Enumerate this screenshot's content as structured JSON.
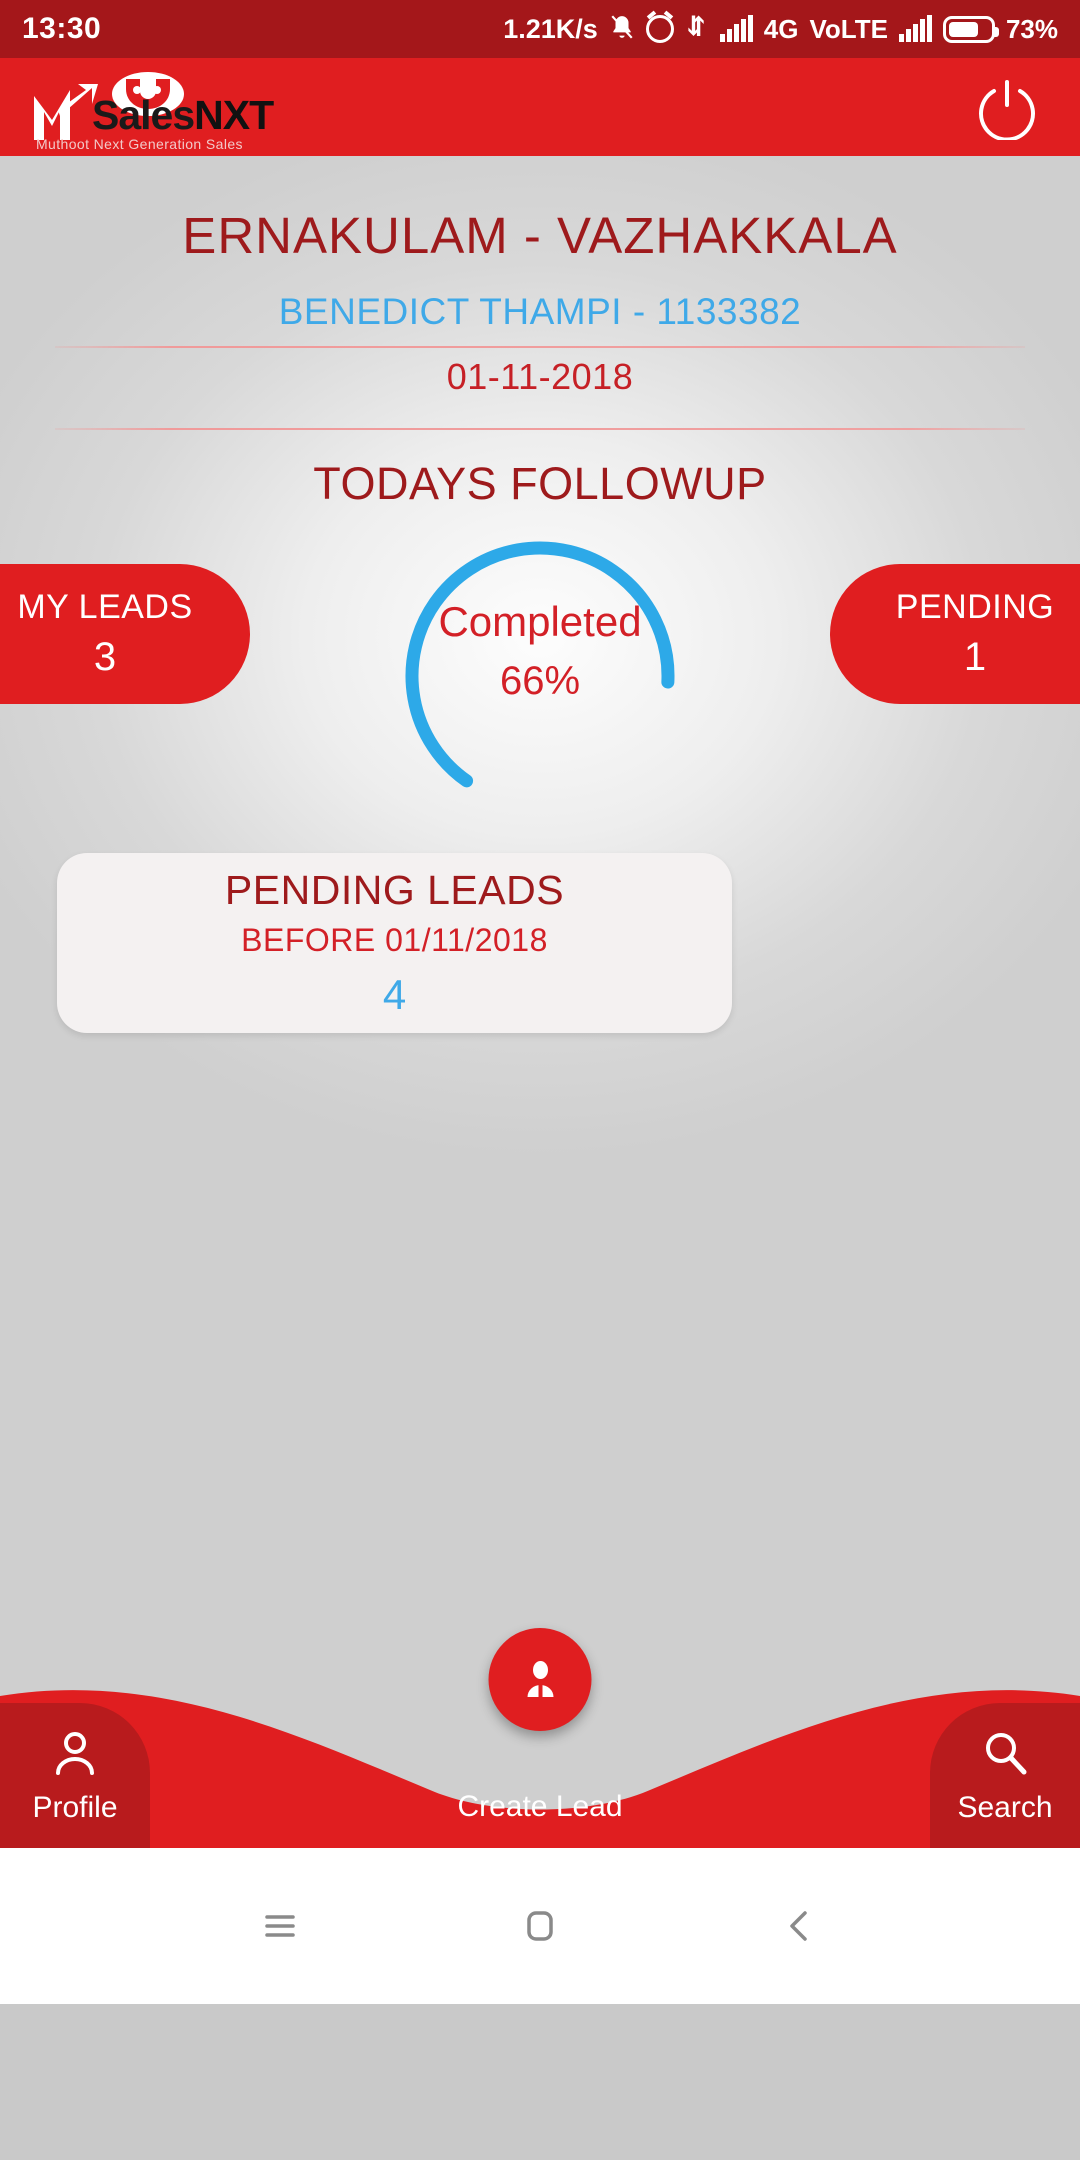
{
  "status_bar": {
    "time": "13:30",
    "net_speed": "1.21K/s",
    "network_type": "4G",
    "volte": "VoLTE",
    "battery": "73%",
    "icons": [
      "bell-muted-icon",
      "alarm-icon",
      "data-transfer-icon",
      "signal-bars-icon",
      "signal-bars-icon",
      "battery-icon"
    ]
  },
  "app_header": {
    "brand_m": "M",
    "brand_name": "SalesNXT",
    "tagline": "Muthoot Next Generation Sales",
    "power_icon": "power-icon"
  },
  "main": {
    "branch": "ERNAKULAM - VAZHAKKALA",
    "agent": "BENEDICT THAMPI - 1133382",
    "date": "01-11-2018",
    "section_title": "TODAYS FOLLOWUP",
    "progress": {
      "label": "Completed",
      "percent_text": "66%",
      "percent_value": 66
    },
    "my_leads": {
      "label": "MY LEADS",
      "value": "3"
    },
    "pending": {
      "label": "PENDING",
      "value": "1"
    },
    "pending_leads_card": {
      "title": "PENDING LEADS",
      "subtitle": "BEFORE 01/11/2018",
      "count": "4"
    }
  },
  "bottom_nav": {
    "profile": {
      "label": "Profile",
      "icon": "person-icon"
    },
    "create_lead": {
      "label": "Create Lead",
      "icon": "add-person-icon"
    },
    "search": {
      "label": "Search",
      "icon": "search-icon"
    }
  },
  "android_nav": {
    "recents": "menu-icon",
    "home": "home-icon",
    "back": "back-icon"
  },
  "colors": {
    "brand_red": "#e01e20",
    "dark_red": "#9e1a1c",
    "status_bar_red": "#a4171a",
    "accent_blue": "#3fa9e8",
    "progress_blue": "#2da9e8",
    "card_bg": "#f4f1f1"
  }
}
